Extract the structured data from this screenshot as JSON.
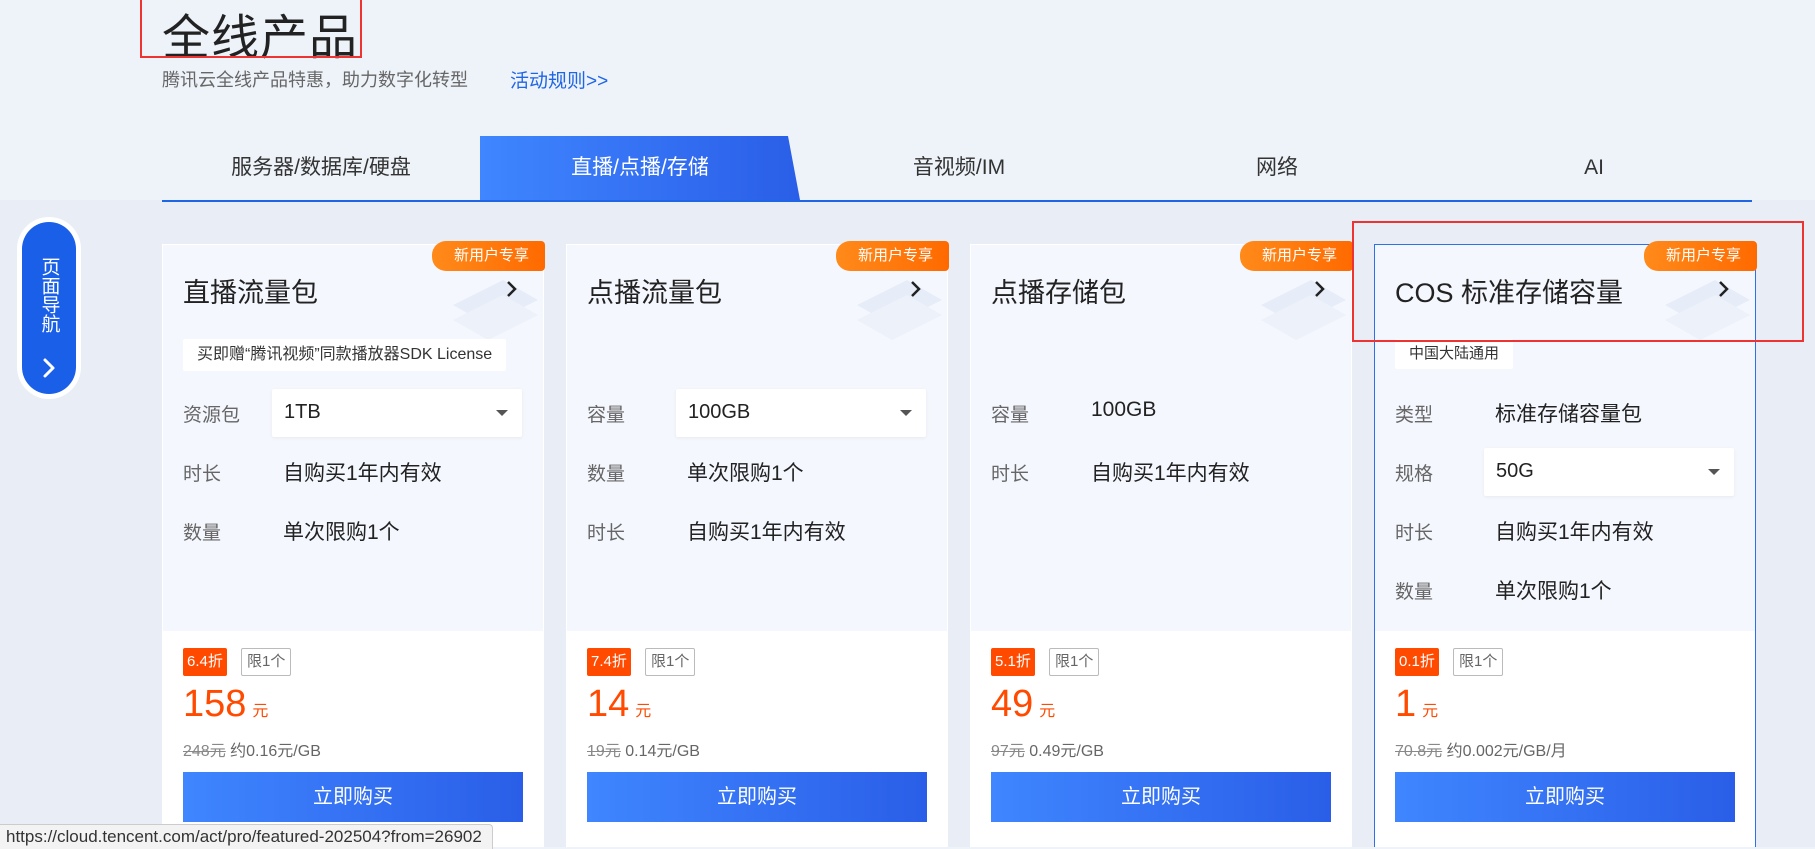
{
  "header": {
    "title": "全线产品",
    "subtitle": "腾讯云全线产品特惠，助力数字化转型",
    "rules_link": "活动规则>>"
  },
  "tabs": [
    {
      "label": "服务器/数据库/硬盘",
      "active": false
    },
    {
      "label": "直播/点播/存储",
      "active": true
    },
    {
      "label": "音视频/IM",
      "active": false
    },
    {
      "label": "网络",
      "active": false
    },
    {
      "label": "AI",
      "active": false
    }
  ],
  "side_nav": {
    "label": "页面导航",
    "icon": "chevron-right-icon"
  },
  "accent_color": "#1f66e5",
  "discount_color": "#ff4a00",
  "cards": [
    {
      "badge": "新用户专享",
      "title": "直播流量包",
      "note": "买即赠“腾讯视频”同款播放器SDK License",
      "rows": [
        {
          "label": "资源包",
          "value": "1TB",
          "type": "select"
        },
        {
          "label": "时长",
          "value": "自购买1年内有效"
        },
        {
          "label": "数量",
          "value": "单次限购1个"
        }
      ],
      "discount": "6.4折",
      "limit": "限1个",
      "price": "158",
      "price_unit": "元",
      "original_price": "248元",
      "unit_price": "约0.16元/GB",
      "buy_label": "立即购买"
    },
    {
      "badge": "新用户专享",
      "title": "点播流量包",
      "rows": [
        {
          "label": "容量",
          "value": "100GB",
          "type": "select"
        },
        {
          "label": "数量",
          "value": "单次限购1个"
        },
        {
          "label": "时长",
          "value": "自购买1年内有效"
        }
      ],
      "discount": "7.4折",
      "limit": "限1个",
      "price": "14",
      "price_unit": "元",
      "original_price": "19元",
      "unit_price": "0.14元/GB",
      "buy_label": "立即购买"
    },
    {
      "badge": "新用户专享",
      "title": "点播存储包",
      "rows": [
        {
          "label": "容量",
          "value": "100GB"
        },
        {
          "label": "时长",
          "value": "自购买1年内有效"
        }
      ],
      "discount": "5.1折",
      "limit": "限1个",
      "price": "49",
      "price_unit": "元",
      "original_price": "97元",
      "unit_price": "0.49元/GB",
      "buy_label": "立即购买"
    },
    {
      "badge": "新用户专享",
      "title": "COS 标准存储容量",
      "note": "中国大陆通用",
      "rows": [
        {
          "label": "类型",
          "value": "标准存储容量包"
        },
        {
          "label": "规格",
          "value": "50G",
          "type": "select"
        },
        {
          "label": "时长",
          "value": "自购买1年内有效"
        },
        {
          "label": "数量",
          "value": "单次限购1个"
        }
      ],
      "discount": "0.1折",
      "limit": "限1个",
      "price": "1",
      "price_unit": "元",
      "original_price": "70.8元",
      "unit_price": "约0.002元/GB/月",
      "buy_label": "立即购买"
    }
  ],
  "status_bar": {
    "url": "https://cloud.tencent.com/act/pro/featured-202504?from=26902"
  }
}
